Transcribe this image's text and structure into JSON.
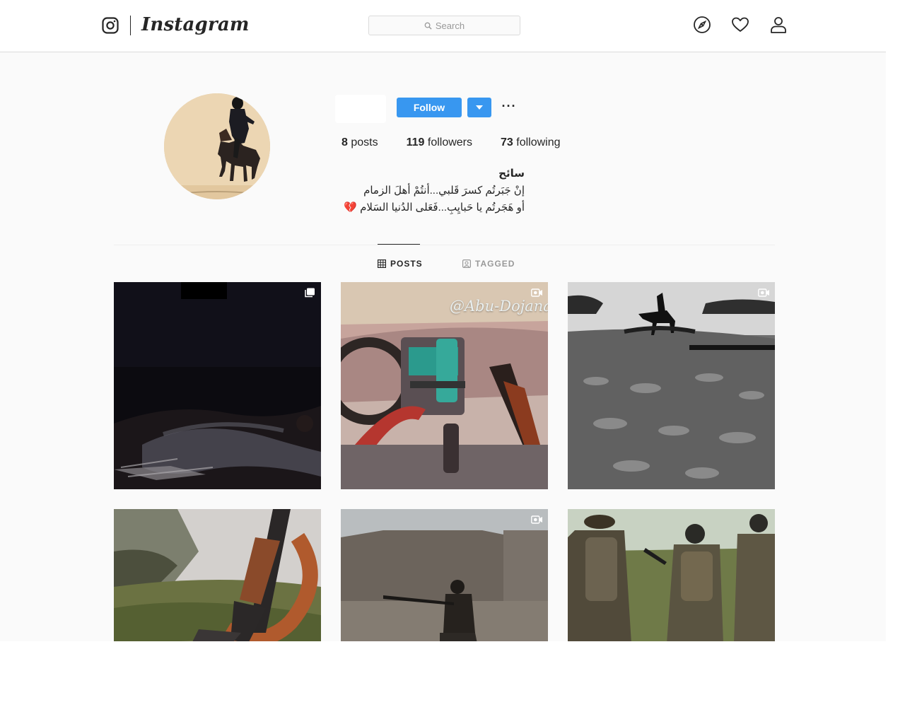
{
  "header": {
    "brand": "Instagram",
    "search_placeholder": "Search"
  },
  "profile": {
    "follow_label": "Follow",
    "more_label": "···",
    "stats": [
      {
        "count": "8",
        "label": "posts"
      },
      {
        "count": "119",
        "label": "followers"
      },
      {
        "count": "73",
        "label": "following"
      }
    ],
    "bio": {
      "name": "سائح",
      "line1": "إنْ جَبَرتُم كسرَ قَلبي...أنتُمْ أهلَ الزمام",
      "line2": "أو هَجَرتُم يا حَبايِبِ...فَعَلى الدُنيا السَلام 💔"
    }
  },
  "tabs": [
    {
      "label": "POSTS",
      "active": true
    },
    {
      "label": "TAGGED",
      "active": false
    }
  ],
  "posts": [
    {
      "type": "carousel",
      "overlay_text": ""
    },
    {
      "type": "video",
      "overlay_text": "@Abu-Dojana"
    },
    {
      "type": "video",
      "overlay_text": ""
    },
    {
      "type": "image",
      "overlay_text": ""
    },
    {
      "type": "video",
      "overlay_text": ""
    },
    {
      "type": "image",
      "overlay_text": ""
    }
  ],
  "colors": {
    "accent": "#3897f0",
    "border": "#dbdbdb",
    "background": "#fafafa",
    "text": "#262626",
    "muted": "#999999"
  }
}
